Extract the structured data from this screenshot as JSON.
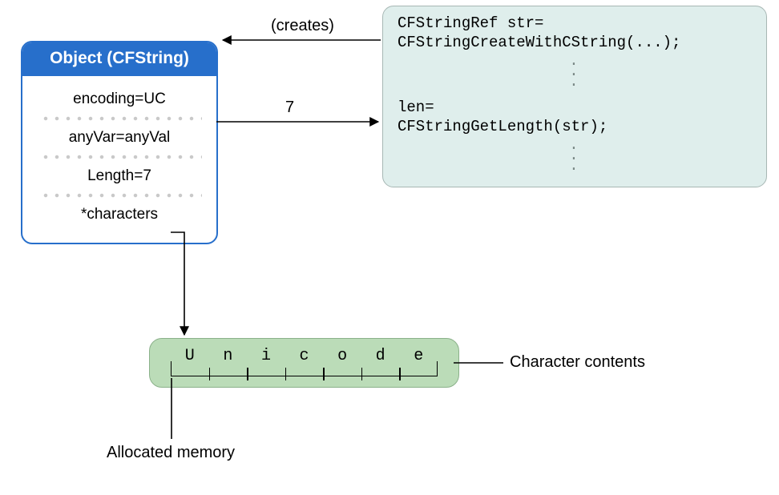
{
  "object_card": {
    "title": "Object (CFString)",
    "rows": [
      "encoding=UC",
      "anyVar=anyVal",
      "Length=7",
      "*characters"
    ]
  },
  "code_block": {
    "line1": "CFStringRef str=",
    "line2": "CFStringCreateWithCString(...);",
    "line3": "len=",
    "line4": "CFStringGetLength(str);"
  },
  "arrows": {
    "creates_label": "(creates)",
    "length_value": "7"
  },
  "memory": {
    "chars": [
      "U",
      "n",
      "i",
      "c",
      "o",
      "d",
      "e"
    ],
    "contents_label": "Character contents",
    "allocated_label": "Allocated memory"
  }
}
